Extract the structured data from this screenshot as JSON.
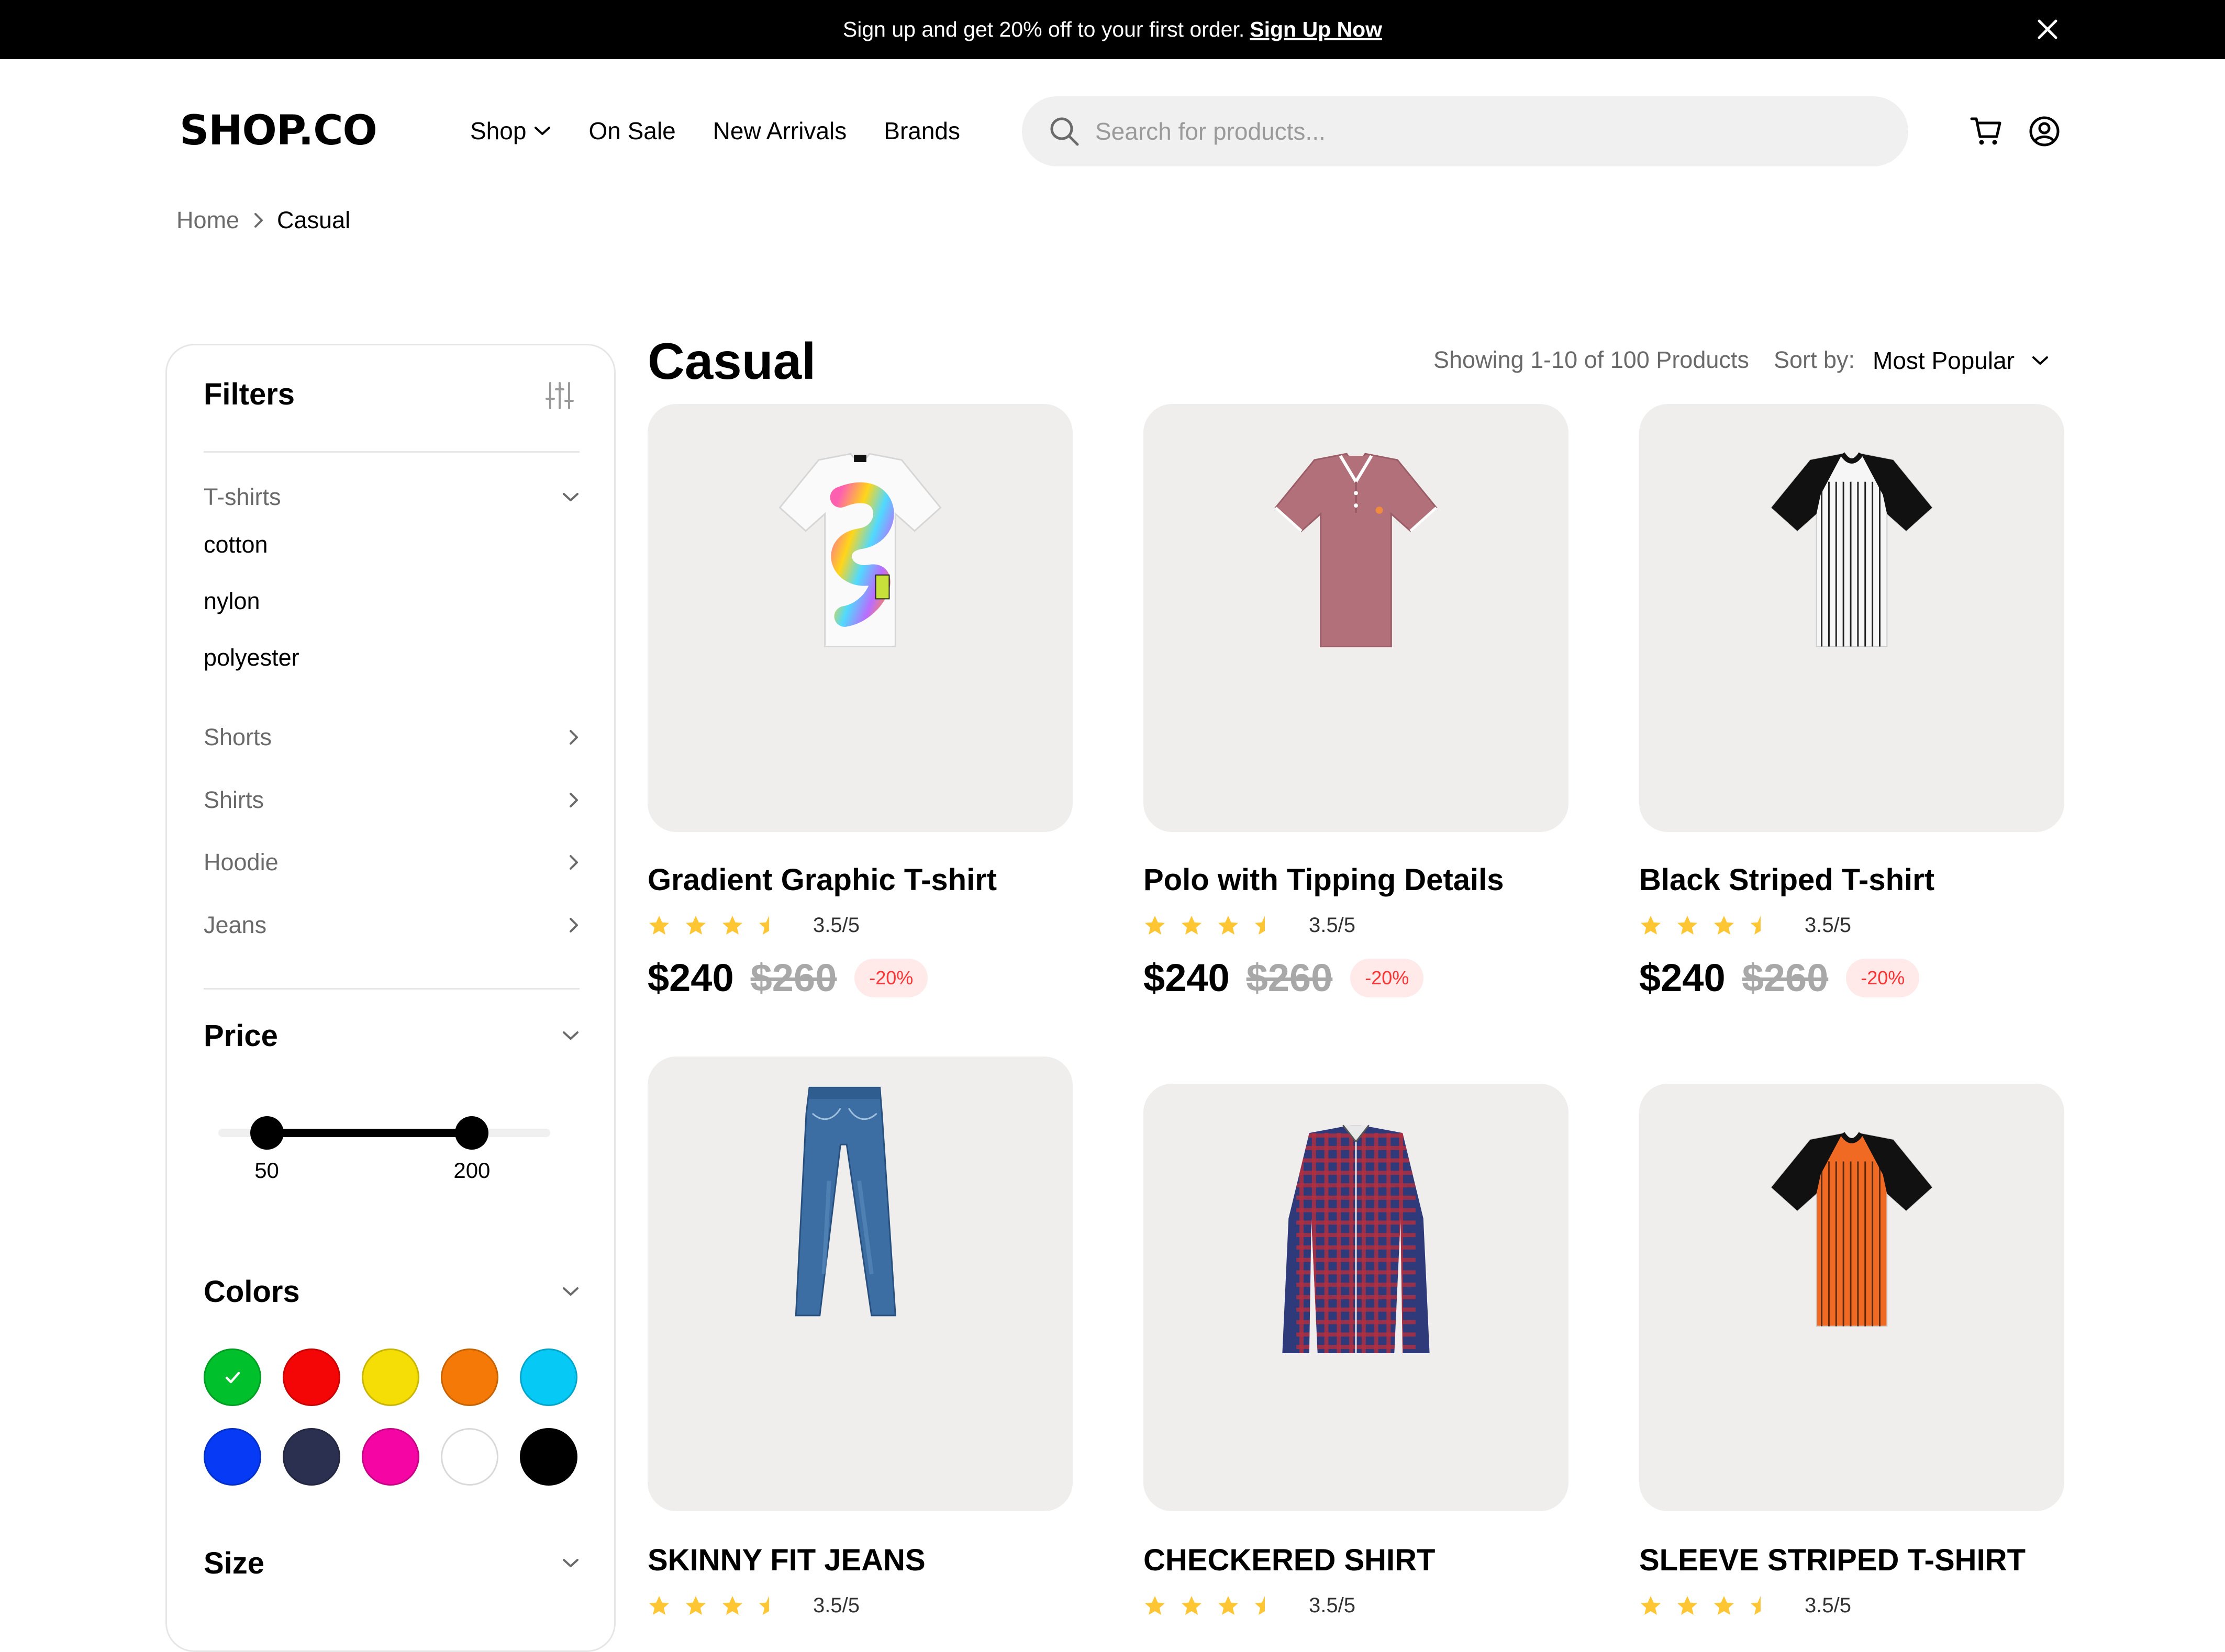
{
  "promo": {
    "text": "Sign up and get 20% off to your first order.",
    "link": "Sign Up Now"
  },
  "header": {
    "logo": "SHOP.CO",
    "nav": [
      "Shop",
      "On Sale",
      "New Arrivals",
      "Brands"
    ],
    "search_placeholder": "Search for products..."
  },
  "breadcrumb": {
    "home": "Home",
    "current": "Casual"
  },
  "filters": {
    "title": "Filters",
    "category_open": "T-shirts",
    "sub_items": [
      "cotton",
      "nylon",
      "polyester"
    ],
    "categories": [
      "Shorts",
      "Shirts",
      "Hoodie",
      "Jeans"
    ],
    "price_heading": "Price",
    "price_min": "50",
    "price_max": "200",
    "price_range_fraction": [
      0.146,
      0.764
    ],
    "colors_heading": "Colors",
    "colors": [
      "#00c12b",
      "#f50606",
      "#f5dd06",
      "#f57906",
      "#06caf5",
      "#063af5",
      "#2b3050",
      "#f506a4",
      "#ffffff",
      "#000000"
    ],
    "selected_color": "#00c12b",
    "size_heading": "Size"
  },
  "main": {
    "title": "Casual",
    "showing": "Showing 1-10 of 100 Products",
    "sort_label": "Sort by:",
    "sort_value": "Most Popular"
  },
  "products": [
    {
      "name": "Gradient Graphic T-shirt",
      "rating_text": "3.5/5",
      "rating": 3.5,
      "price": "$240",
      "old_price": "$260",
      "discount": "-20%",
      "icon": "gradient-tshirt"
    },
    {
      "name": "Polo with Tipping Details",
      "rating_text": "3.5/5",
      "rating": 3.5,
      "price": "$240",
      "old_price": "$260",
      "discount": "-20%",
      "icon": "polo-shirt"
    },
    {
      "name": "Black Striped T-shirt",
      "rating_text": "3.5/5",
      "rating": 3.5,
      "price": "$240",
      "old_price": "$260",
      "discount": "-20%",
      "icon": "striped-tshirt"
    },
    {
      "name": "SKINNY FIT JEANS",
      "rating_text": "3.5/5",
      "rating": 3.5,
      "icon": "jeans"
    },
    {
      "name": "CHECKERED SHIRT",
      "rating_text": "3.5/5",
      "rating": 3.5,
      "icon": "checkered-shirt"
    },
    {
      "name": "SLEEVE STRIPED T-SHIRT",
      "rating_text": "3.5/5",
      "rating": 3.5,
      "icon": "orange-striped-tshirt"
    }
  ]
}
